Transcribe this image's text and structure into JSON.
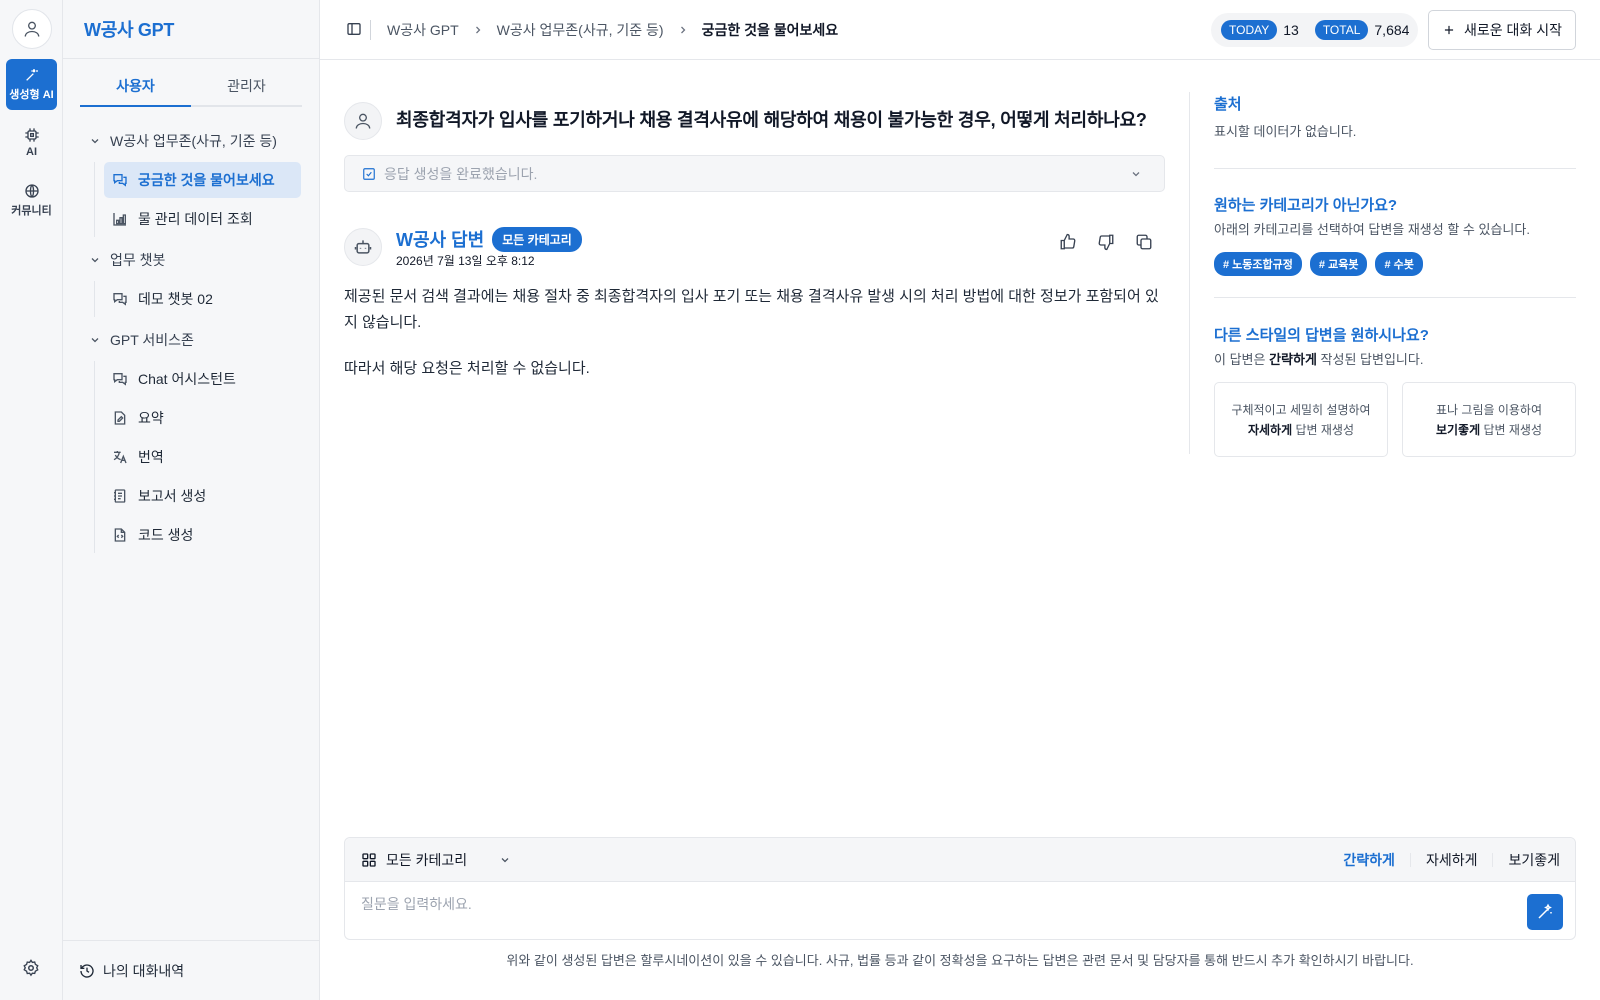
{
  "rail": {
    "items": [
      {
        "label": "생성형 AI",
        "icon": "magic-wand-icon"
      },
      {
        "label": "AI",
        "icon": "chip-icon"
      },
      {
        "label": "커뮤니티",
        "icon": "globe-icon"
      }
    ]
  },
  "sidebar": {
    "brand": "W공사 GPT",
    "tabs": [
      "사용자",
      "관리자"
    ],
    "groups": [
      {
        "label": "W공사 업무존(사규, 기준 등)",
        "items": [
          {
            "label": "궁금한 것을 물어보세요",
            "icon": "chat-icon",
            "active": true
          },
          {
            "label": "물 관리 데이터 조회",
            "icon": "chart-icon"
          }
        ]
      },
      {
        "label": "업무 챗봇",
        "items": [
          {
            "label": "데모 챗봇 02",
            "icon": "chat-icon"
          }
        ]
      },
      {
        "label": "GPT 서비스존",
        "items": [
          {
            "label": "Chat 어시스턴트",
            "icon": "chat-icon"
          },
          {
            "label": "요약",
            "icon": "edit-doc-icon"
          },
          {
            "label": "번역",
            "icon": "translate-icon"
          },
          {
            "label": "보고서 생성",
            "icon": "notebook-icon"
          },
          {
            "label": "코드 생성",
            "icon": "code-file-icon"
          }
        ]
      }
    ],
    "history_label": "나의 대화내역"
  },
  "header": {
    "breadcrumb": [
      "W공사 GPT",
      "W공사 업무존(사규, 기준 등)",
      "궁금한 것을 물어보세요"
    ],
    "today_label": "TODAY",
    "today_count": "13",
    "total_label": "TOTAL",
    "total_count": "7,684",
    "new_chat_label": "새로운 대화 시작"
  },
  "conversation": {
    "question": "최종합격자가 입사를 포기하거나 채용 결격사유에 해당하여 채용이 불가능한 경우, 어떻게 처리하나요?",
    "status": "응답 생성을 완료했습니다.",
    "answer_name": "W공사 답변",
    "answer_category": "모든 카테고리",
    "answer_date": "2026년 7월 13일 오후 8:12",
    "answer_paragraphs": [
      "제공된 문서 검색 결과에는 채용 절차 중 최종합격자의 입사 포기 또는 채용 결격사유 발생 시의 처리 방법에 대한 정보가 포함되어 있지 않습니다.",
      "따라서 해당 요청은 처리할 수 없습니다."
    ]
  },
  "right_panel": {
    "source_title": "출처",
    "source_empty": "표시할 데이터가 없습니다.",
    "category_title": "원하는 카테고리가 아닌가요?",
    "category_sub": "아래의 카테고리를 선택하여 답변을 재생성 할 수 있습니다.",
    "tags": [
      "# 노동조합규정",
      "# 교육봇",
      "# 수봇"
    ],
    "style_title": "다른 스타일의 답변을 원하시나요?",
    "style_sub_prefix": "이 답변은 ",
    "style_sub_bold": "간략하게",
    "style_sub_suffix": " 작성된 답변입니다.",
    "cards": [
      {
        "line1": "구체적이고 세밀히 설명하여",
        "bold": "자세하게",
        "rest": " 답변 재생성"
      },
      {
        "line1": "표나 그림을 이용하여",
        "bold": "보기좋게",
        "rest": " 답변 재생성"
      }
    ]
  },
  "composer": {
    "category": "모든 카테고리",
    "styles": [
      "간략하게",
      "자세하게",
      "보기좋게"
    ],
    "active_style": "간략하게",
    "placeholder": "질문을 입력하세요.",
    "disclaimer": "위와 같이 생성된 답변은 할루시네이션이 있을 수 있습니다. 사규, 법률 등과 같이 정확성을 요구하는 답변은 관련 문서 및 담당자를 통해 반드시 추가 확인하시기 바랍니다."
  },
  "colors": {
    "accent": "#1c6fd1",
    "active_bg": "#dbe7f7"
  }
}
